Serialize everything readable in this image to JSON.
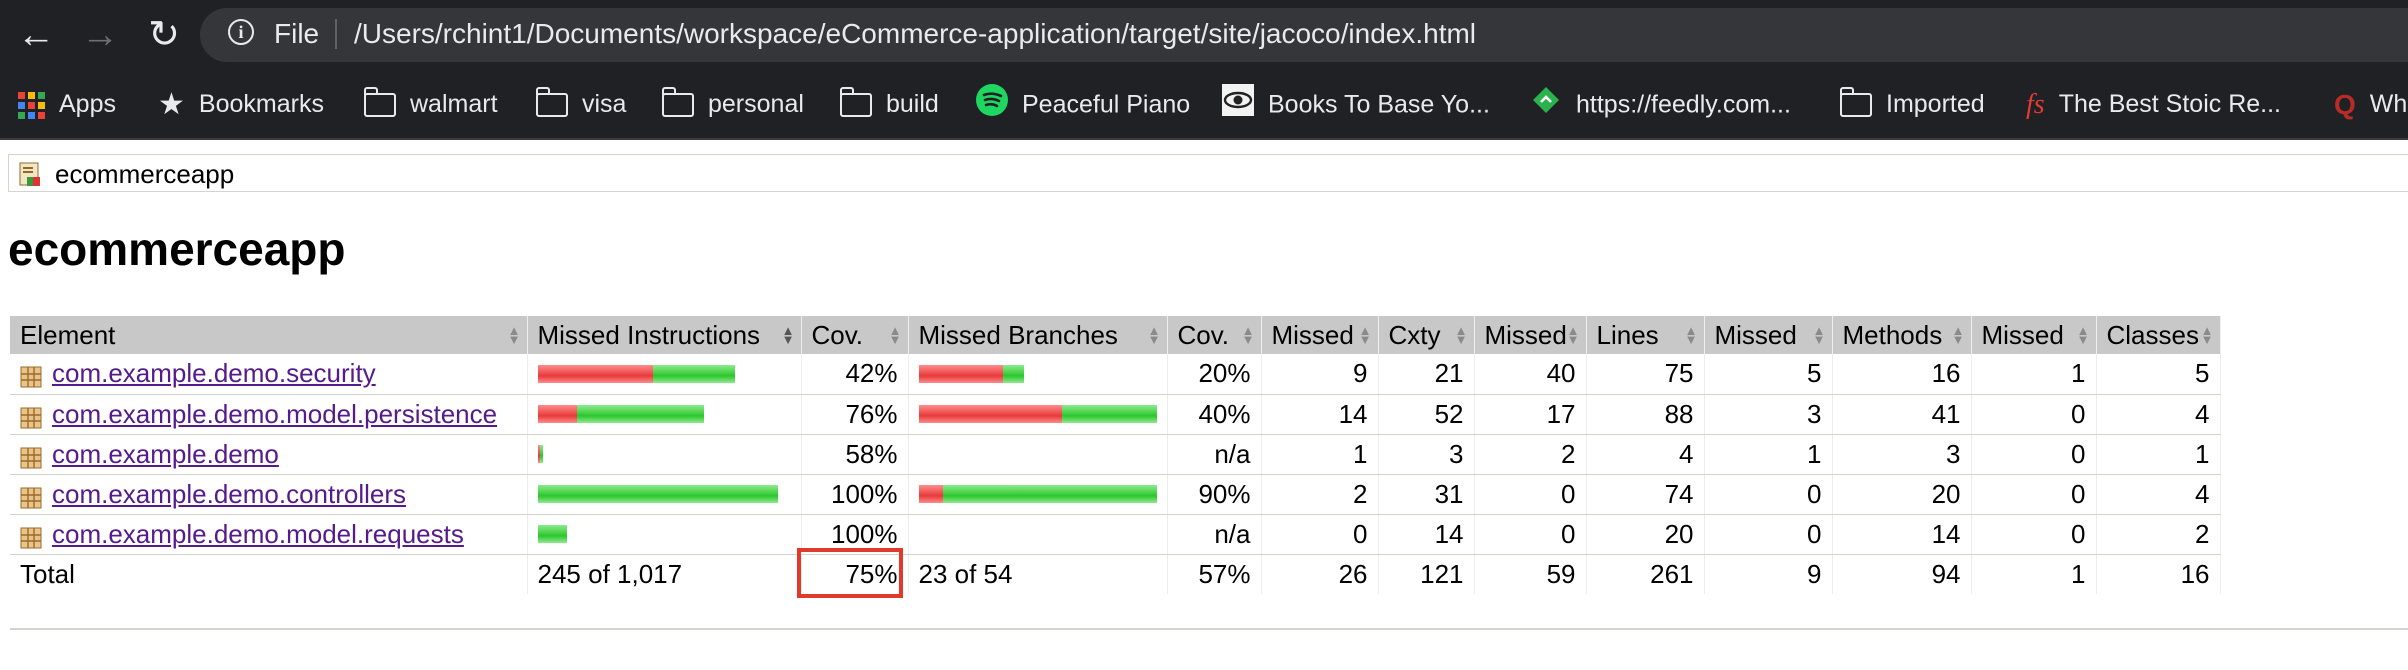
{
  "browser": {
    "scheme_label": "File",
    "url": "/Users/rchint1/Documents/workspace/eCommerce-application/target/site/jacoco/index.html",
    "bookmarks": [
      {
        "label": "Apps",
        "icon": "apps-grid-icon"
      },
      {
        "label": "Bookmarks",
        "icon": "star-icon"
      },
      {
        "label": "walmart",
        "icon": "folder-icon"
      },
      {
        "label": "visa",
        "icon": "folder-icon"
      },
      {
        "label": "personal",
        "icon": "folder-icon"
      },
      {
        "label": "build",
        "icon": "folder-icon"
      },
      {
        "label": "Peaceful Piano",
        "icon": "spotify-icon"
      },
      {
        "label": "Books To Base Yo...",
        "icon": "eye-icon"
      },
      {
        "label": "https://feedly.com...",
        "icon": "feedly-icon"
      },
      {
        "label": "Imported",
        "icon": "folder-icon"
      },
      {
        "label": "The Best Stoic Re...",
        "icon": "fs-icon"
      },
      {
        "label": "Wh",
        "icon": "quora-icon"
      }
    ]
  },
  "breadcrumb": {
    "label": "ecommerceapp"
  },
  "page": {
    "title": "ecommerceapp"
  },
  "table": {
    "headers": {
      "element": "Element",
      "missed_instructions": "Missed Instructions",
      "cov_instructions": "Cov.",
      "missed_branches": "Missed Branches",
      "cov_branches": "Cov.",
      "missed_cxty": "Missed",
      "cxty": "Cxty",
      "missed_lines": "Missed",
      "lines": "Lines",
      "missed_methods": "Missed",
      "methods": "Methods",
      "missed_classes": "Missed",
      "classes": "Classes"
    },
    "rows": [
      {
        "name": "com.example.demo.security",
        "instr_missed_frac": 0.585,
        "instr_covered_frac": 0.415,
        "instr_total_frac": 0.82,
        "instr_cov": "42%",
        "branch_missed_frac": 0.8,
        "branch_covered_frac": 0.2,
        "branch_total_frac": 0.44,
        "branch_cov": "20%",
        "missed_cxty": "9",
        "cxty": "21",
        "missed_lines": "40",
        "lines": "75",
        "missed_methods": "5",
        "methods": "16",
        "missed_classes": "1",
        "classes": "5"
      },
      {
        "name": "com.example.demo.model.persistence",
        "instr_missed_frac": 0.235,
        "instr_covered_frac": 0.765,
        "instr_total_frac": 0.69,
        "instr_cov": "76%",
        "branch_missed_frac": 0.6,
        "branch_covered_frac": 0.4,
        "branch_total_frac": 1.0,
        "branch_cov": "40%",
        "missed_cxty": "14",
        "cxty": "52",
        "missed_lines": "17",
        "lines": "88",
        "missed_methods": "3",
        "methods": "41",
        "missed_classes": "0",
        "classes": "4"
      },
      {
        "name": "com.example.demo",
        "instr_missed_frac": 0.42,
        "instr_covered_frac": 0.58,
        "instr_total_frac": 0.02,
        "instr_cov": "58%",
        "branch_missed_frac": 0,
        "branch_covered_frac": 0,
        "branch_total_frac": 0,
        "branch_cov": "n/a",
        "missed_cxty": "1",
        "cxty": "3",
        "missed_lines": "2",
        "lines": "4",
        "missed_methods": "1",
        "methods": "3",
        "missed_classes": "0",
        "classes": "1"
      },
      {
        "name": "com.example.demo.controllers",
        "instr_missed_frac": 0,
        "instr_covered_frac": 1,
        "instr_total_frac": 1.0,
        "instr_cov": "100%",
        "branch_missed_frac": 0.1,
        "branch_covered_frac": 0.9,
        "branch_total_frac": 1.0,
        "branch_cov": "90%",
        "missed_cxty": "2",
        "cxty": "31",
        "missed_lines": "0",
        "lines": "74",
        "missed_methods": "0",
        "methods": "20",
        "missed_classes": "0",
        "classes": "4"
      },
      {
        "name": "com.example.demo.model.requests",
        "instr_missed_frac": 0,
        "instr_covered_frac": 1,
        "instr_total_frac": 0.12,
        "instr_cov": "100%",
        "branch_missed_frac": 0,
        "branch_covered_frac": 0,
        "branch_total_frac": 0,
        "branch_cov": "n/a",
        "missed_cxty": "0",
        "cxty": "14",
        "missed_lines": "0",
        "lines": "20",
        "missed_methods": "0",
        "methods": "14",
        "missed_classes": "0",
        "classes": "2"
      }
    ],
    "total": {
      "label": "Total",
      "instructions": "245 of 1,017",
      "instr_cov": "75%",
      "branches": "23 of 54",
      "branch_cov": "57%",
      "missed_cxty": "26",
      "cxty": "121",
      "missed_lines": "59",
      "lines": "261",
      "missed_methods": "9",
      "methods": "94",
      "missed_classes": "1",
      "classes": "16"
    }
  },
  "colors": {
    "missed": "#e83a3a",
    "covered": "#2ec52e",
    "highlight": "#e23a2a",
    "link": "#551a8b"
  }
}
